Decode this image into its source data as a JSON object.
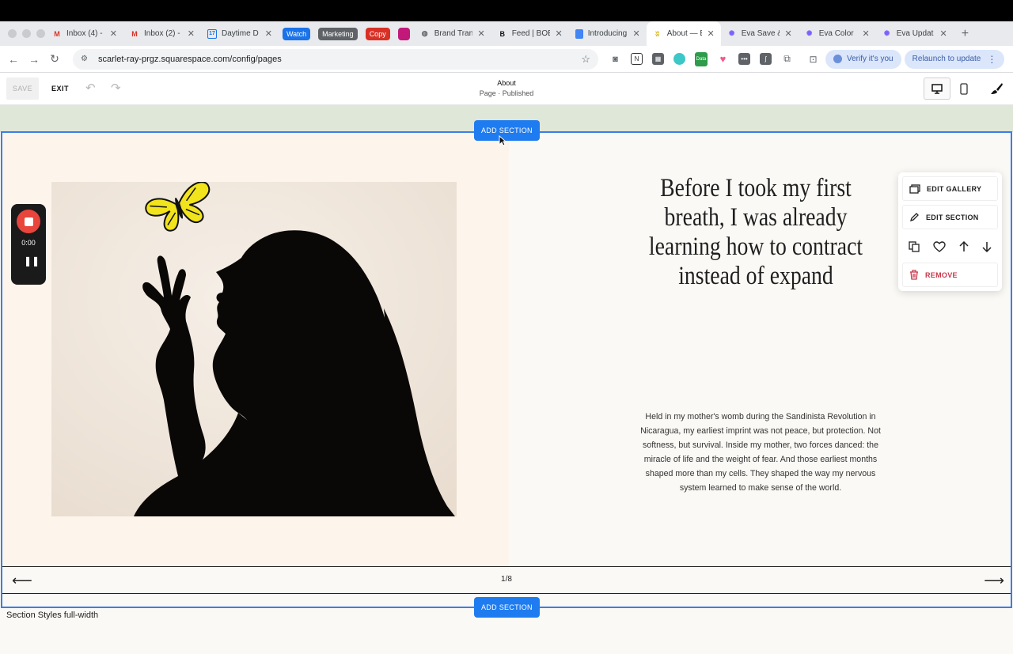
{
  "browser": {
    "tabs": [
      {
        "title": "Inbox (4) -",
        "icon": "gmail-icon",
        "color": "#d93025"
      },
      {
        "title": "Inbox (2) -",
        "icon": "gmail-icon",
        "color": "#d93025"
      },
      {
        "title": "Daytime D",
        "icon": "calendar-icon",
        "color": "#1a73e8"
      },
      {
        "title": "Brand Tran",
        "icon": "globe-icon",
        "color": "#5f6368"
      },
      {
        "title": "Feed | BOE",
        "icon": "b-icon",
        "color": "#111111"
      },
      {
        "title": "Introducing",
        "icon": "docs-icon",
        "color": "#4285f4"
      },
      {
        "title": "About — E",
        "icon": "butterfly-icon",
        "color": "#d4b106"
      },
      {
        "title": "Eva Save &",
        "icon": "claude-icon",
        "color": "#7b61ff"
      },
      {
        "title": "Eva Color",
        "icon": "claude-icon",
        "color": "#7b61ff"
      },
      {
        "title": "Eva Updat",
        "icon": "claude-icon",
        "color": "#7b61ff"
      }
    ],
    "tab_groups": [
      {
        "label": "Watch",
        "color": "#1a73e8"
      },
      {
        "label": "Marketing",
        "color": "#5f6368"
      },
      {
        "label": "Copy",
        "color": "#d93025"
      }
    ],
    "url": "scarlet-ray-prgz.squarespace.com/config/pages",
    "verify_label": "Verify it's you",
    "relaunch_label": "Relaunch to update",
    "ext_data_label": "Data"
  },
  "editor": {
    "save_label": "SAVE",
    "exit_label": "EXIT",
    "page_title": "About",
    "page_status": "Page · Published"
  },
  "section": {
    "add_section_label": "ADD SECTION",
    "heading": "Before I took my first breath, I was already learning how to contract instead of expand",
    "body": "Held in my mother's womb during the Sandinista Revolution in Nicaragua, my earliest imprint was not peace, but protection. Not softness, but survival. Inside my mother, two forces danced: the miracle of life and the weight of fear. And those earliest months shaped more than my cells. They shaped the way my nervous system learned to make sense of the world.",
    "slide_counter": "1/8",
    "style_label": "Section Styles full-width"
  },
  "popover": {
    "edit_gallery": "EDIT GALLERY",
    "edit_section": "EDIT SECTION",
    "remove": "REMOVE"
  },
  "recorder": {
    "time": "0:00"
  },
  "colors": {
    "accent": "#1f7cf0",
    "section_outline": "#3a7fe5",
    "remove": "#c8384a",
    "butterfly": "#f1e31c"
  }
}
